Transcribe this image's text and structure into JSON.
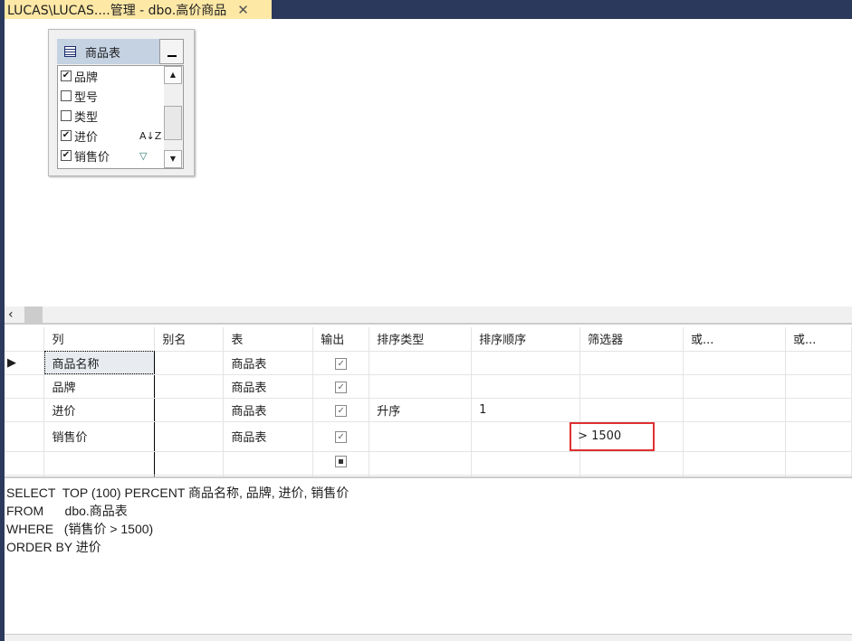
{
  "tab": {
    "title": "LUCAS\\LUCAS....管理 - dbo.高价商品",
    "close": "✕"
  },
  "diagram": {
    "table_name": "商品表",
    "fields": [
      {
        "name": "品牌",
        "checked": true,
        "ext": ""
      },
      {
        "name": "型号",
        "checked": false,
        "ext": ""
      },
      {
        "name": "类型",
        "checked": false,
        "ext": ""
      },
      {
        "name": "进价",
        "checked": true,
        "ext": "A↓Z"
      },
      {
        "name": "销售价",
        "checked": true,
        "ext": "▽"
      }
    ]
  },
  "grid": {
    "headers": [
      "列",
      "别名",
      "表",
      "输出",
      "排序类型",
      "排序顺序",
      "筛选器",
      "或...",
      "或..."
    ],
    "rows": [
      {
        "col": "商品名称",
        "alias": "",
        "table": "商品表",
        "output": true,
        "sort_type": "",
        "sort_order": "",
        "filter": ""
      },
      {
        "col": "品牌",
        "alias": "",
        "table": "商品表",
        "output": true,
        "sort_type": "",
        "sort_order": "",
        "filter": ""
      },
      {
        "col": "进价",
        "alias": "",
        "table": "商品表",
        "output": true,
        "sort_type": "升序",
        "sort_order": "1",
        "filter": ""
      },
      {
        "col": "销售价",
        "alias": "",
        "table": "商品表",
        "output": true,
        "sort_type": "",
        "sort_order": "",
        "filter": "> 1500"
      }
    ]
  },
  "sql": [
    "SELECT  TOP (100) PERCENT 商品名称, 品牌, 进价, 销售价",
    "FROM      dbo.商品表",
    "WHERE   (销售价 > 1500)",
    "ORDER BY 进价"
  ]
}
